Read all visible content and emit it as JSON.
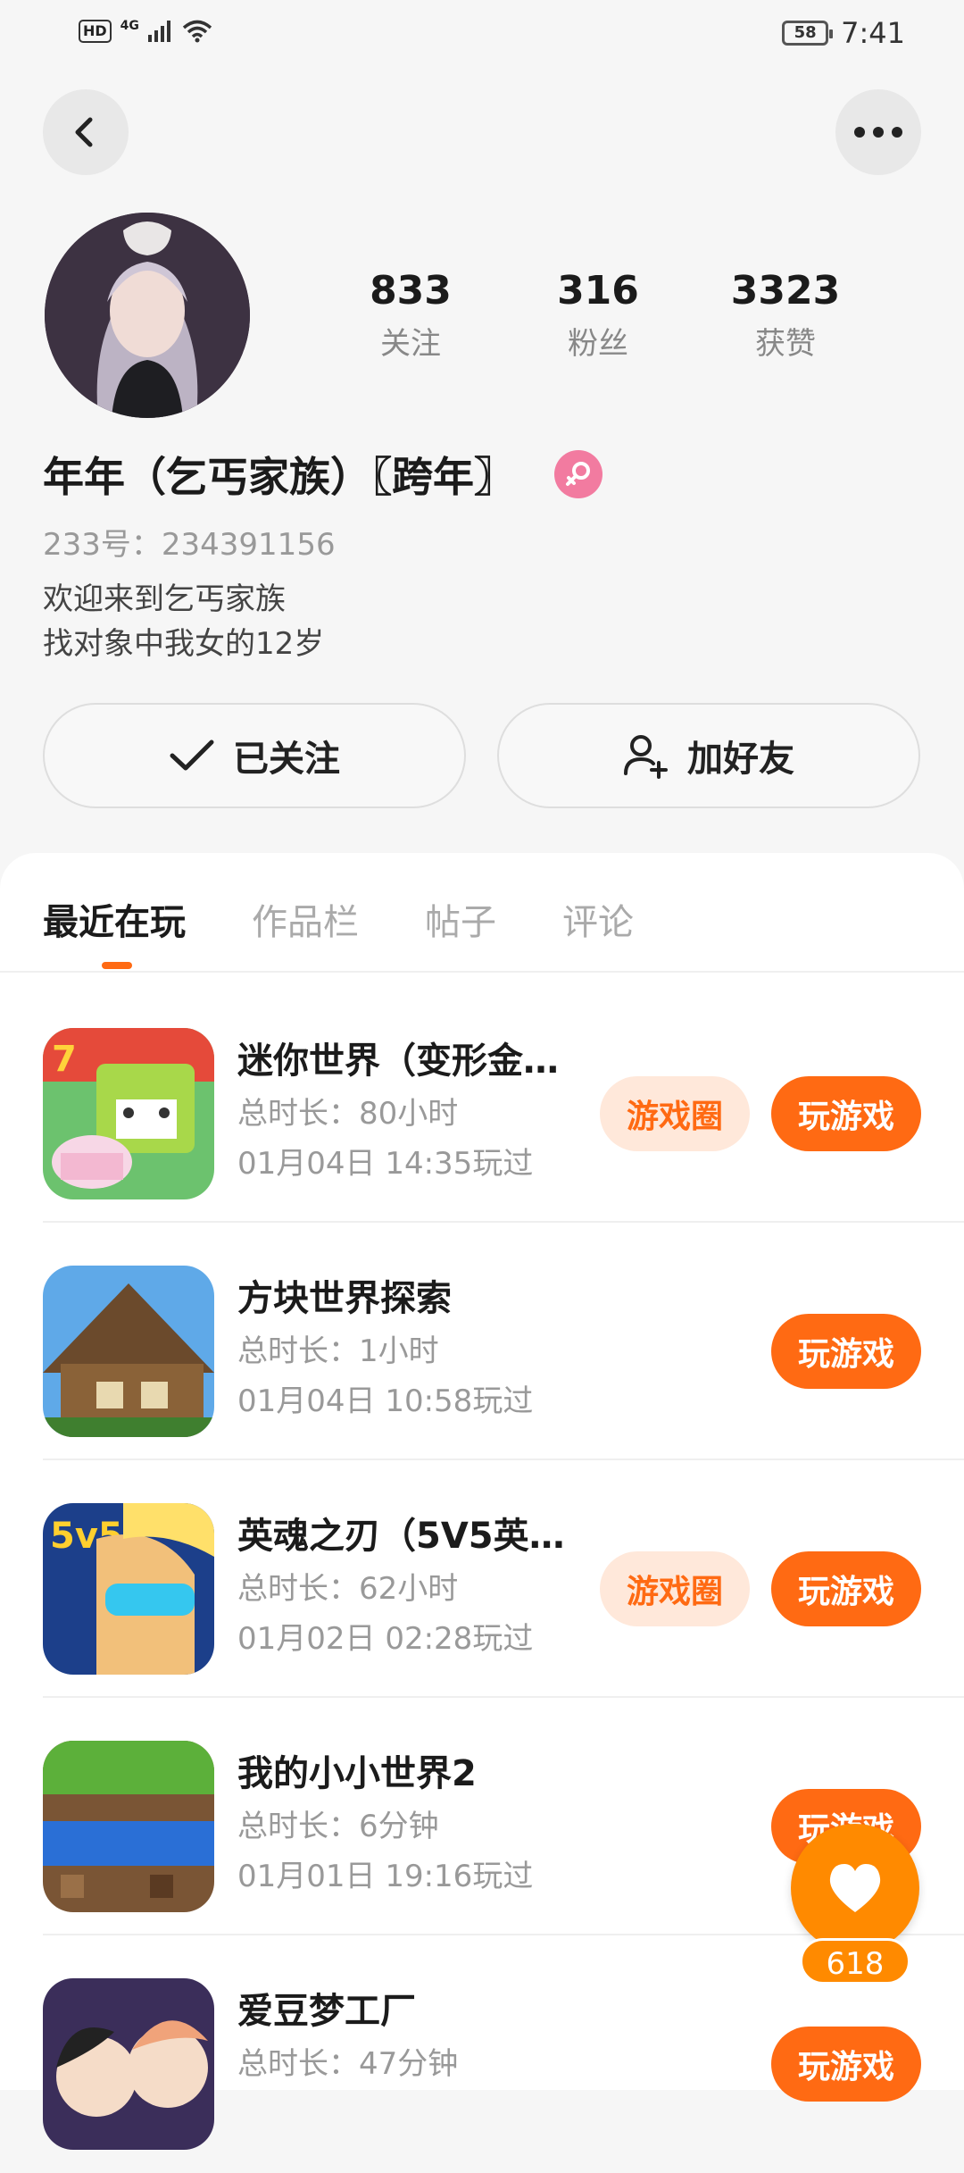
{
  "status_bar": {
    "hd": "HD",
    "network": "4G",
    "battery": "58",
    "time": "7:41"
  },
  "profile": {
    "stats": [
      {
        "value": "833",
        "label": "关注"
      },
      {
        "value": "316",
        "label": "粉丝"
      },
      {
        "value": "3323",
        "label": "获赞"
      }
    ],
    "name": "年年（乞丐家族）〖跨年〗",
    "uid": "233号：234391156",
    "bio_line1": "欢迎来到乞丐家族",
    "bio_line2": "找对象中我女的12岁",
    "follow_label": "已关注",
    "add_friend_label": "加好友",
    "gender_color": "#f27ba0"
  },
  "tabs": [
    "最近在玩",
    "作品栏",
    "帖子",
    "评论"
  ],
  "games": [
    {
      "title": "迷你世界（变形金…",
      "duration": "总时长：80小时",
      "last_played": "01月04日 14:35玩过",
      "circle": "游戏圈",
      "play": "玩游戏"
    },
    {
      "title": "方块世界探索",
      "duration": "总时长：1小时",
      "last_played": "01月04日 10:58玩过",
      "play": "玩游戏"
    },
    {
      "title": "英魂之刃（5V5英…",
      "duration": "总时长：62小时",
      "last_played": "01月02日 02:28玩过",
      "circle": "游戏圈",
      "play": "玩游戏"
    },
    {
      "title": "我的小小世界2",
      "duration": "总时长：6分钟",
      "last_played": "01月01日 19:16玩过",
      "play": "玩游戏"
    },
    {
      "title": "爱豆梦工厂",
      "duration": "总时长：47分钟",
      "last_played": "",
      "play": "玩游戏"
    }
  ],
  "like_count": "618",
  "colors": {
    "accent": "#ff6a13",
    "circle_bg": "#ffe8da"
  }
}
